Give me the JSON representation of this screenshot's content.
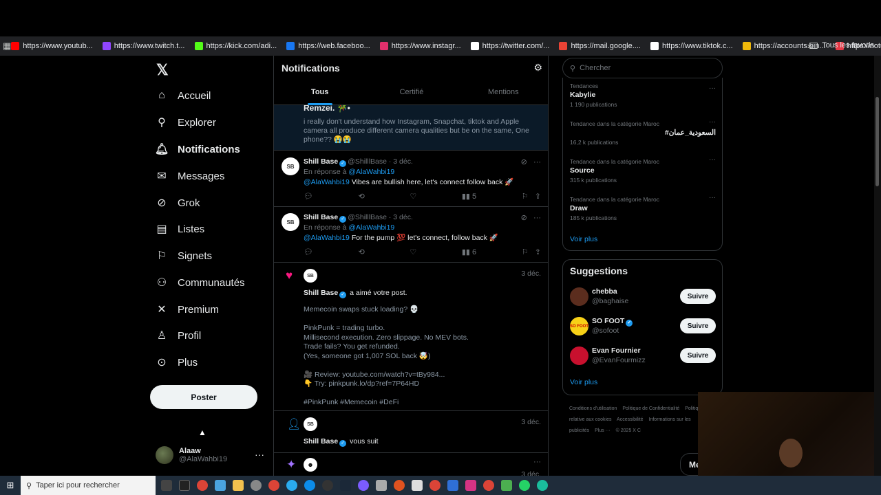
{
  "browser": {
    "bookmarks": [
      {
        "label": "https://www.youtub...",
        "color": "#ff0000"
      },
      {
        "label": "https://www.twitch.t...",
        "color": "#9146ff"
      },
      {
        "label": "https://kick.com/adi...",
        "color": "#53fc18"
      },
      {
        "label": "https://web.faceboo...",
        "color": "#1877f2"
      },
      {
        "label": "https://www.instagr...",
        "color": "#e1306c"
      },
      {
        "label": "https://twitter.com/...",
        "color": "#ffffff"
      },
      {
        "label": "https://mail.google....",
        "color": "#ea4335"
      },
      {
        "label": "https://www.tiktok.c...",
        "color": "#ffffff"
      },
      {
        "label": "https://accounts.bin...",
        "color": "#f0b90b"
      },
      {
        "label": "https://notube.lol/fr...",
        "color": "#e63946"
      }
    ],
    "all_bookmarks": "Tous les favoris"
  },
  "nav": {
    "items": [
      {
        "label": "Accueil",
        "icon": "home-icon"
      },
      {
        "label": "Explorer",
        "icon": "search-icon"
      },
      {
        "label": "Notifications",
        "icon": "bell-icon"
      },
      {
        "label": "Messages",
        "icon": "mail-icon"
      },
      {
        "label": "Grok",
        "icon": "grok-icon"
      },
      {
        "label": "Listes",
        "icon": "list-icon"
      },
      {
        "label": "Signets",
        "icon": "bookmark-icon"
      },
      {
        "label": "Communautés",
        "icon": "communities-icon"
      },
      {
        "label": "Premium",
        "icon": "x-icon"
      },
      {
        "label": "Profil",
        "icon": "profile-icon"
      },
      {
        "label": "Plus",
        "icon": "more-icon"
      }
    ],
    "post_button": "Poster",
    "account": {
      "name": "Alaaw",
      "handle": "@AlaWahbi19"
    }
  },
  "center": {
    "title": "Notifications",
    "tabs": [
      "Tous",
      "Certifié",
      "Mentions"
    ],
    "first_notification": {
      "name": "Remzei. 🎋•",
      "text": "i really don't understand how Instagram, Snapchat, tiktok and Apple camera all produce different camera qualities but be on the same, One phone?? 😭😭"
    },
    "tweets": [
      {
        "name": "Shill Base",
        "handle": "@ShilllBase",
        "date": "· 3 déc.",
        "reply_prefix": "En réponse à",
        "reply_to": "@AlaWahbi19",
        "mention": "@AlaWahbi19",
        "body": "Vibes are bullish here, let's connect follow back 🚀",
        "views": "5"
      },
      {
        "name": "Shill Base",
        "handle": "@ShilllBase",
        "date": "· 3 déc.",
        "reply_prefix": "En réponse à",
        "reply_to": "@AlaWahbi19",
        "mention": "@AlaWahbi19",
        "body": "For the pump 💯 let's connect, follow back 🚀",
        "views": "6"
      }
    ],
    "like_notification": {
      "date": "3 déc.",
      "name": "Shill Base",
      "action": "a aimé votre post.",
      "body": "Memecoin swaps stuck loading? 💀\n\nPinkPunk = trading turbo.\nMillisecond execution. Zero slippage. No MEV bots.\nTrade fails? You get refunded.\n(Yes, someone got 1,007 SOL back 🤯)\n\n🎥 Review: youtube.com/watch?v=tBy984...\n👇 Try: pinkpunk.lo/dp?ref=7P64HD\n\n#PinkPunk #Memecoin #DeFi"
    },
    "follow_notification": {
      "date": "3 déc.",
      "name": "Shill Base",
      "action": "vous suit"
    },
    "next_notification": {
      "date": "3 déc."
    }
  },
  "right": {
    "search_placeholder": "Chercher",
    "trends": [
      {
        "category": "Tendances",
        "name": "Kabylie",
        "count": "1 190 publications"
      },
      {
        "category": "Tendance dans la catégorie Maroc",
        "name": "#السعودية_عمان",
        "count": "16,2 k publications"
      },
      {
        "category": "Tendance dans la catégorie Maroc",
        "name": "Source",
        "count": "315 k publications"
      },
      {
        "category": "Tendance dans la catégorie Maroc",
        "name": "Draw",
        "count": "185 k publications"
      }
    ],
    "trends_more": "Voir plus",
    "suggestions_title": "Suggestions",
    "suggestions": [
      {
        "name": "chebba",
        "handle": "@baghaise",
        "verified": false,
        "avatar": "#5b2d1e"
      },
      {
        "name": "SO FOOT",
        "handle": "@sofoot",
        "verified": true,
        "avatar": "#f7d117"
      },
      {
        "name": "Evan Fournier",
        "handle": "@EvanFourmizz",
        "verified": false,
        "avatar": "#c8102e"
      }
    ],
    "follow_label": "Suivre",
    "suggestions_more": "Voir plus",
    "footer": [
      "Conditions d'utilisation",
      "Politique de Confidentialité",
      "Politique relative aux cookies",
      "Accessibilité",
      "Informations sur les publicités",
      "Plus ···",
      "© 2025 X C"
    ]
  },
  "messages_pill": "Me",
  "taskbar": {
    "search_placeholder": "Taper ici pour rechercher"
  }
}
